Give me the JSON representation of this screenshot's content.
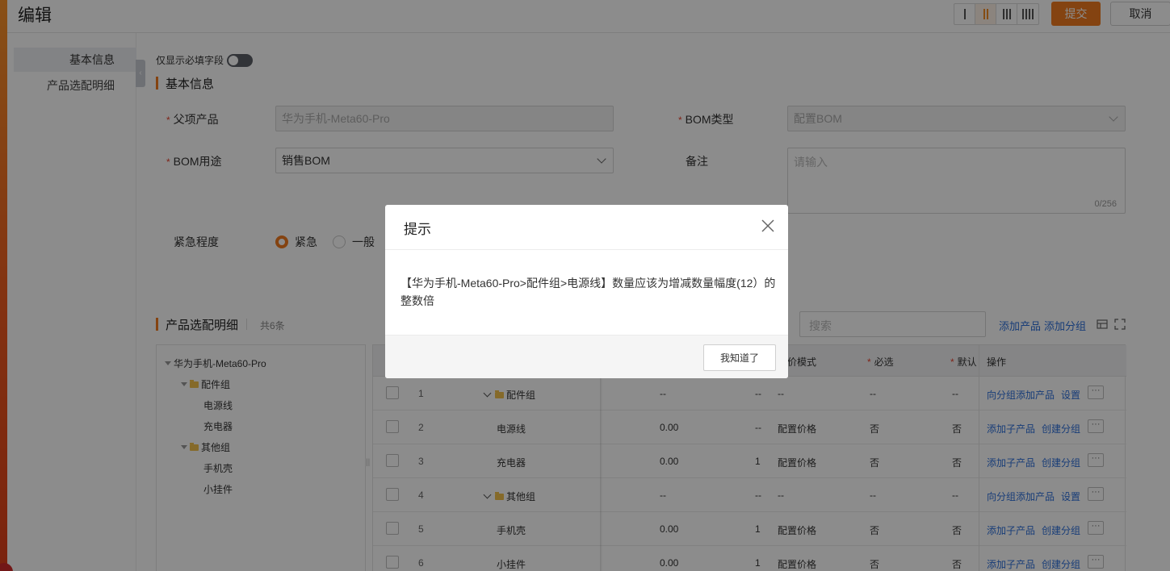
{
  "header": {
    "title": "编辑",
    "layout_options": [
      "single-column-icon",
      "two-column-icon",
      "three-column-icon",
      "four-column-icon"
    ],
    "active_layout": "two-column-icon",
    "submit_label": "提交",
    "cancel_label": "取消"
  },
  "anchor_nav": {
    "items": [
      {
        "label": "基本信息",
        "active": true
      },
      {
        "label": "产品选配明细",
        "active": false
      }
    ]
  },
  "required_toggle_label": "仅显示必填字段",
  "basic_section": {
    "title": "基本信息",
    "fields": {
      "parent_product": {
        "label": "父项产品",
        "value": "华为手机-Meta60-Pro",
        "required": true
      },
      "bom_type": {
        "label": "BOM类型",
        "value": "配置BOM",
        "required": true
      },
      "bom_usage": {
        "label": "BOM用途",
        "value": "销售BOM",
        "required": true
      },
      "remark": {
        "label": "备注",
        "placeholder": "请输入",
        "counter": "0/256"
      },
      "urgency": {
        "label": "紧急程度",
        "options": [
          "紧急",
          "一般"
        ],
        "selected": "紧急"
      }
    }
  },
  "detail_section": {
    "title": "产品选配明细",
    "count": "共6条",
    "search_placeholder": "搜索",
    "add_product_label": "添加产品",
    "add_group_label": "添加分组",
    "tree": {
      "root": "华为手机-Meta60-Pro",
      "groups": [
        {
          "name": "配件组",
          "children": [
            "电源线",
            "充电器"
          ]
        },
        {
          "name": "其他组",
          "children": [
            "手机壳",
            "小挂件"
          ]
        }
      ]
    },
    "columns": {
      "pricing_mode": "定价模式",
      "required": "必选",
      "default": "默认",
      "actions": "操作"
    },
    "rows": [
      {
        "index": "1",
        "name": "配件组",
        "is_group": true,
        "price": "--",
        "qty": "--",
        "pricing_mode": "--",
        "required": "--",
        "default": "--",
        "action1": "向分组添加产品",
        "action2": "设置",
        "more": "···"
      },
      {
        "index": "2",
        "name": "电源线",
        "is_group": false,
        "price": "0.00",
        "qty": "--",
        "pricing_mode": "配置价格",
        "required": "否",
        "default": "否",
        "action1": "添加子产品",
        "action2": "创建分组",
        "more": "···"
      },
      {
        "index": "3",
        "name": "充电器",
        "is_group": false,
        "price": "0.00",
        "qty": "1",
        "pricing_mode": "配置价格",
        "required": "否",
        "default": "否",
        "action1": "添加子产品",
        "action2": "创建分组",
        "more": "···"
      },
      {
        "index": "4",
        "name": "其他组",
        "is_group": true,
        "price": "--",
        "qty": "--",
        "pricing_mode": "--",
        "required": "--",
        "default": "--",
        "action1": "向分组添加产品",
        "action2": "设置",
        "more": "···"
      },
      {
        "index": "5",
        "name": "手机壳",
        "is_group": false,
        "price": "0.00",
        "qty": "1",
        "pricing_mode": "配置价格",
        "required": "否",
        "default": "否",
        "action1": "添加子产品",
        "action2": "创建分组",
        "more": "···"
      },
      {
        "index": "6",
        "name": "小挂件",
        "is_group": false,
        "price": "0.00",
        "qty": "1",
        "pricing_mode": "配置价格",
        "required": "否",
        "default": "否",
        "action1": "添加子产品",
        "action2": "创建分组",
        "more": "···"
      }
    ]
  },
  "dialog": {
    "title": "提示",
    "message": "【华为手机-Meta60-Pro>配件组>电源线】数量应该为增减数量幅度(12）的整数倍",
    "ok_label": "我知道了"
  },
  "colors": {
    "accent": "#f07b1f",
    "link": "#2d6fdb",
    "required_star": "#e8432e"
  }
}
